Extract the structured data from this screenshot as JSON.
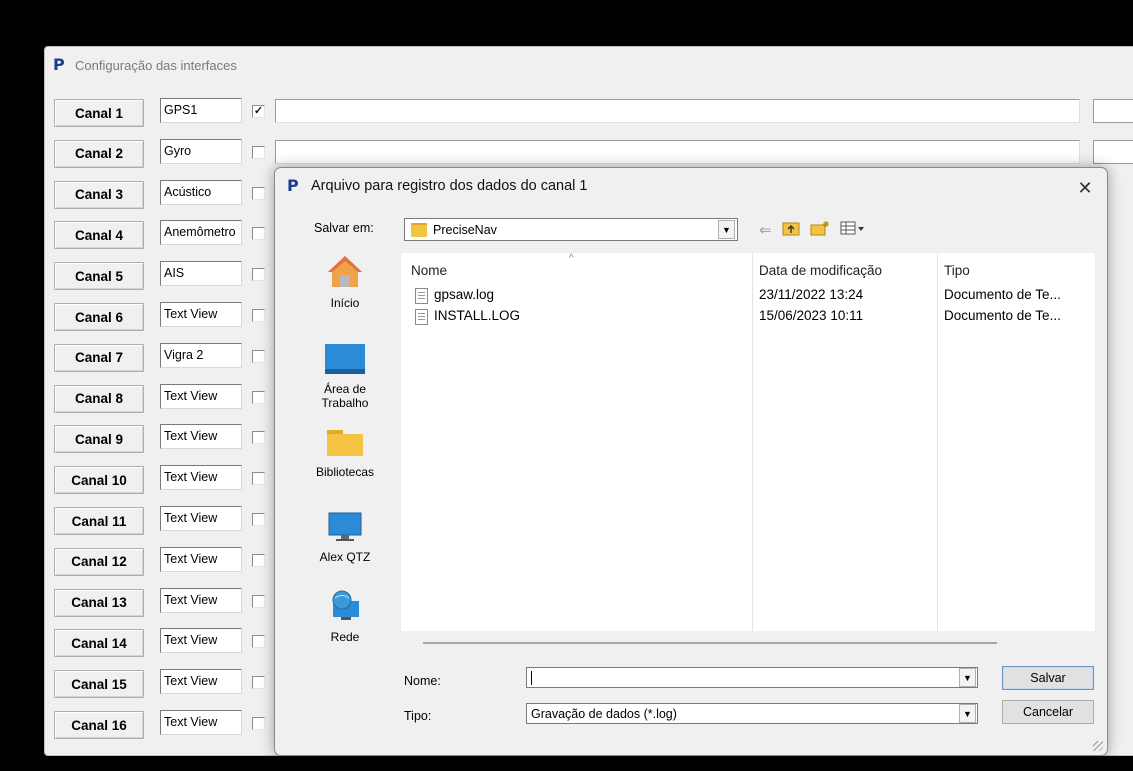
{
  "main_window": {
    "title": "Configuração das interfaces",
    "channels": [
      {
        "label": "Canal 1",
        "name": "GPS1",
        "checked": true
      },
      {
        "label": "Canal 2",
        "name": "Gyro",
        "checked": false
      },
      {
        "label": "Canal 3",
        "name": "Acústico",
        "checked": false
      },
      {
        "label": "Canal 4",
        "name": "Anemômetro",
        "checked": false
      },
      {
        "label": "Canal 5",
        "name": "AIS",
        "checked": false
      },
      {
        "label": "Canal 6",
        "name": "Text View",
        "checked": false
      },
      {
        "label": "Canal 7",
        "name": "Vigra 2",
        "checked": false
      },
      {
        "label": "Canal 8",
        "name": "Text View",
        "checked": false
      },
      {
        "label": "Canal 9",
        "name": "Text View",
        "checked": false
      },
      {
        "label": "Canal 10",
        "name": "Text View",
        "checked": false
      },
      {
        "label": "Canal 11",
        "name": "Text View",
        "checked": false
      },
      {
        "label": "Canal 12",
        "name": "Text View",
        "checked": false
      },
      {
        "label": "Canal 13",
        "name": "Text View",
        "checked": false
      },
      {
        "label": "Canal 14",
        "name": "Text View",
        "checked": false
      },
      {
        "label": "Canal 15",
        "name": "Text View",
        "checked": false
      },
      {
        "label": "Canal 16",
        "name": "Text View",
        "checked": false
      }
    ]
  },
  "dialog": {
    "title": "Arquivo para registro dos dados do canal 1",
    "close_glyph": "✕",
    "save_in_label": "Salvar em:",
    "save_in_value": "PreciseNav",
    "toolbar_icons": [
      "back-arrow-icon",
      "up-folder-icon",
      "new-folder-icon",
      "view-menu-icon"
    ],
    "places": [
      {
        "label": "Início",
        "icon": "home-icon"
      },
      {
        "label": "Área de\nTrabalho",
        "icon": "desktop-icon"
      },
      {
        "label": "Bibliotecas",
        "icon": "libraries-folder-icon"
      },
      {
        "label": "Alex QTZ",
        "icon": "computer-icon"
      },
      {
        "label": "Rede",
        "icon": "network-icon"
      }
    ],
    "columns": {
      "name": "Nome",
      "date": "Data de modificação",
      "type": "Tipo"
    },
    "files": [
      {
        "name": "gpsaw.log",
        "date": "23/11/2022 13:24",
        "type": "Documento de Te..."
      },
      {
        "name": "INSTALL.LOG",
        "date": "15/06/2023 10:11",
        "type": "Documento de Te..."
      }
    ],
    "filename_label": "Nome:",
    "filename_value": "",
    "filetype_label": "Tipo:",
    "filetype_value": "Gravação de dados (*.log)",
    "save_button": "Salvar",
    "cancel_button": "Cancelar"
  },
  "colors": {
    "logo": "#1a3d8f",
    "folder": "#f5c342",
    "accent_border": "#6f8fc7"
  }
}
